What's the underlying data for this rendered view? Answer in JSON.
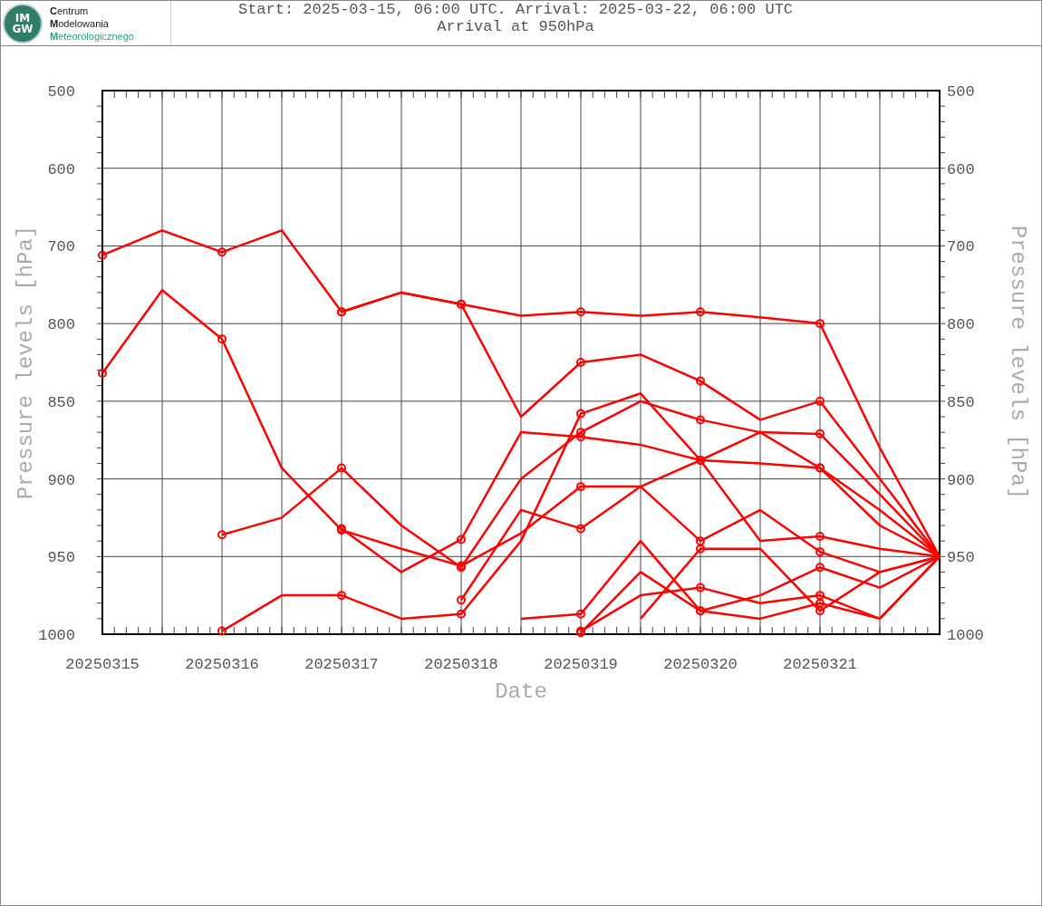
{
  "header": {
    "logo": {
      "mark_lines": [
        "IM",
        "GW"
      ],
      "name_lines": [
        "**C**entrum",
        "**M**odelowania",
        "**M**eteorologicznego"
      ]
    },
    "title_lines": [
      "Start: 2025-03-15, 06:00 UTC. Arrival: 2025-03-22, 06:00 UTC",
      "Arrival at 950hPa"
    ]
  },
  "chart": {
    "y_axis_label": "Pressure levels [hPa]",
    "right_axis_label": "Pressure levels [hPa]",
    "x_axis_label": "Date",
    "y_tick_labels": [
      "500",
      "600",
      "700",
      "800",
      "850",
      "900",
      "950",
      "1000"
    ],
    "right_y_tick_labels": [
      "500",
      "600",
      "700",
      "800",
      "850",
      "900",
      "950",
      "1000"
    ],
    "x_tick_labels": [
      "20250315",
      "20250316",
      "20250317",
      "20250318",
      "20250319",
      "20250320",
      "20250321"
    ]
  }
}
